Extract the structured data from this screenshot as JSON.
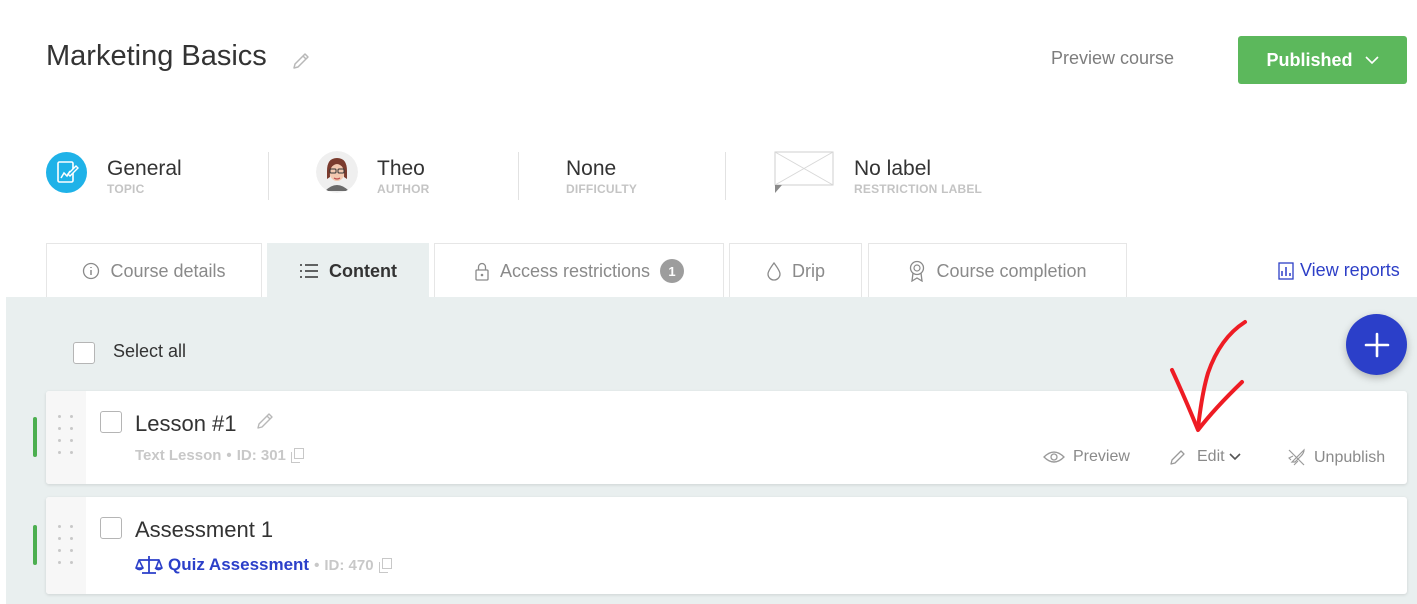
{
  "header": {
    "course_title": "Marketing Basics",
    "preview_course_label": "Preview course",
    "status_button_label": "Published",
    "status_color": "#5cb85c"
  },
  "meta": {
    "topic": {
      "value": "General",
      "label": "TOPIC"
    },
    "author": {
      "value": "Theo",
      "label": "AUTHOR"
    },
    "difficulty": {
      "value": "None",
      "label": "DIFFICULTY"
    },
    "restriction_label": {
      "value": "No label",
      "label": "RESTRICTION LABEL"
    }
  },
  "tabs": [
    {
      "label": "Course details",
      "icon": "info-circle-icon"
    },
    {
      "label": "Content",
      "icon": "list-icon",
      "active": true
    },
    {
      "label": "Access restrictions",
      "icon": "lock-icon",
      "badge": "1"
    },
    {
      "label": "Drip",
      "icon": "drop-icon"
    },
    {
      "label": "Course completion",
      "icon": "award-icon"
    }
  ],
  "view_reports_label": "View reports",
  "content": {
    "select_all_label": "Select all",
    "items": [
      {
        "title": "Lesson #1",
        "type": "Text Lesson",
        "id_label": "ID: 301",
        "actions": {
          "preview": "Preview",
          "edit": "Edit",
          "unpublish": "Unpublish"
        }
      },
      {
        "title": "Assessment 1",
        "type": "Quiz Assessment",
        "id_label": "ID: 470"
      }
    ]
  },
  "colors": {
    "accent": "#2b3fc9",
    "published_green": "#5cb85c",
    "topic_icon": "#1fb2e8",
    "annotation_arrow": "#ee1c24"
  }
}
